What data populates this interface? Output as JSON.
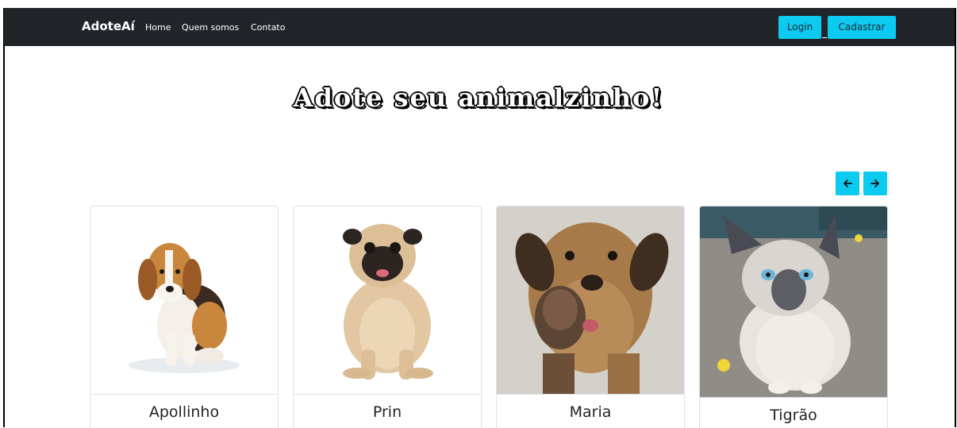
{
  "navbar": {
    "brand": "AdoteAí",
    "links": [
      "Home",
      "Quem somos",
      "Contato"
    ],
    "login_label": "Login",
    "signup_label": "Cadastrar"
  },
  "hero": {
    "title": "Adote seu animalzinho!"
  },
  "carousel": {
    "prev_icon": "arrow-left-icon",
    "next_icon": "arrow-right-icon"
  },
  "pets": [
    {
      "name": "Apollinho",
      "photo": "beagle-photo"
    },
    {
      "name": "Prin",
      "photo": "pug-photo"
    },
    {
      "name": "Maria",
      "photo": "dog-paw-photo"
    },
    {
      "name": "Tigrão",
      "photo": "siamese-cat-photo"
    }
  ],
  "colors": {
    "navbar_bg": "#212529",
    "accent": "#0dcaf0"
  }
}
